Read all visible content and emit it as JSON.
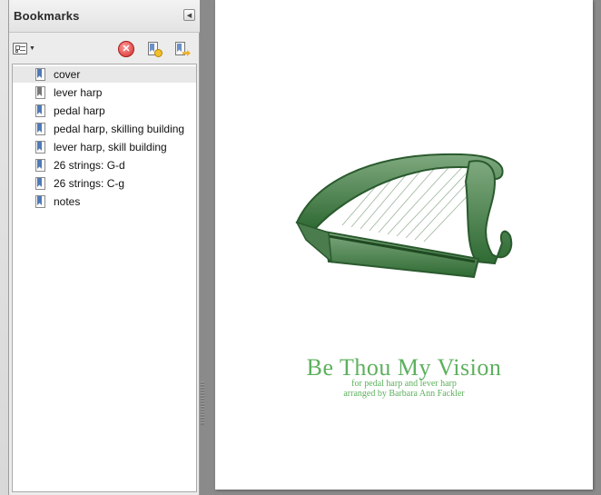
{
  "bookmarks_panel": {
    "title": "Bookmarks",
    "collapse_icon": "triangle-left-icon",
    "toolbar": {
      "options_icon": "options-list-icon",
      "delete_icon": "delete-bookmark-icon",
      "new_icon": "new-bookmark-icon",
      "expand_icon": "expand-bookmark-icon"
    },
    "items": [
      {
        "label": "cover",
        "selected": true
      },
      {
        "label": "lever harp",
        "selected": false
      },
      {
        "label": "pedal harp",
        "selected": false
      },
      {
        "label": "pedal harp, skilling building",
        "selected": false
      },
      {
        "label": "lever harp, skill building",
        "selected": false
      },
      {
        "label": "26 strings: G-d",
        "selected": false
      },
      {
        "label": "26 strings: C-g",
        "selected": false
      },
      {
        "label": "notes",
        "selected": false
      }
    ]
  },
  "document": {
    "title": "Be Thou My Vision",
    "subtitle": "for pedal harp and lever harp",
    "arranger": "arranged by Barbara Ann Fackler",
    "title_color": "#5db05d",
    "illustration": "celtic-harp-illustration"
  }
}
